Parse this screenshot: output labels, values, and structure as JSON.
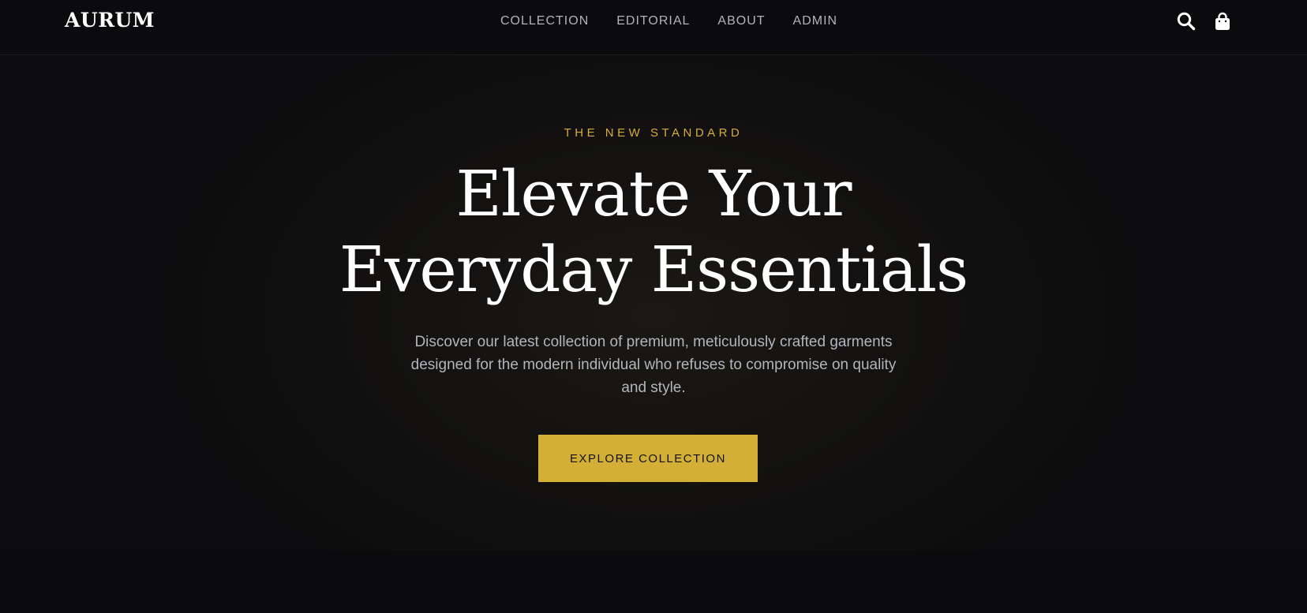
{
  "header": {
    "logo": "AURUM",
    "nav": [
      {
        "label": "COLLECTION"
      },
      {
        "label": "EDITORIAL"
      },
      {
        "label": "ABOUT"
      },
      {
        "label": "ADMIN"
      }
    ],
    "icons": {
      "search": "search-icon",
      "cart": "shopping-bag-icon"
    }
  },
  "hero": {
    "eyebrow": "THE NEW STANDARD",
    "headline_line1": "Elevate Your",
    "headline_line2": "Everyday Essentials",
    "description": "Discover our latest collection of premium, meticulously crafted garments designed for the modern individual who refuses to compromise on quality and style.",
    "cta_label": "EXPLORE COLLECTION"
  },
  "colors": {
    "background": "#0b0b0d",
    "accent": "#d4af37",
    "eyebrow": "#d8ac38",
    "nav_text": "#b3b3b8",
    "body_text": "#b4b4bc"
  }
}
